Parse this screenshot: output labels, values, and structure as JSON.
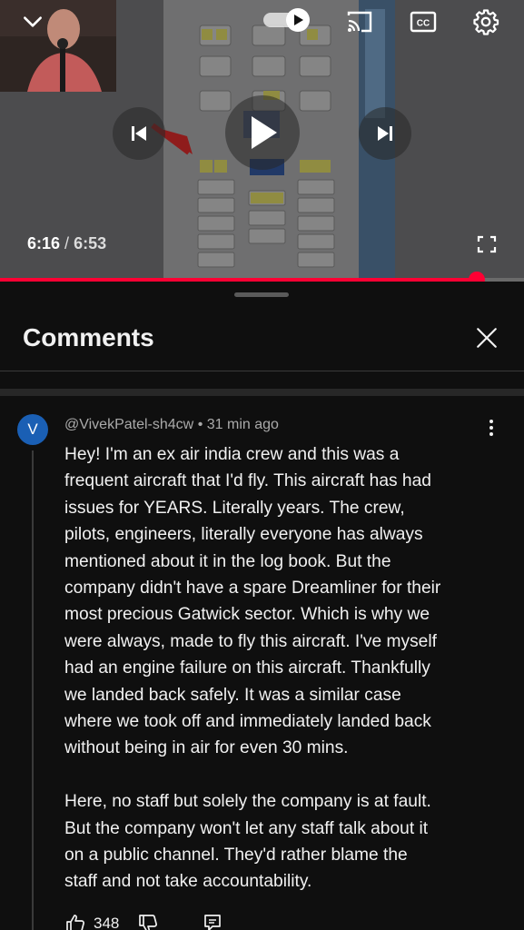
{
  "player": {
    "current_time": "6:16",
    "time_separator": "/",
    "duration": "6:53",
    "progress_fraction": 0.91,
    "accent_color": "#ff0033"
  },
  "controls": {
    "icons": [
      "chevron-down-icon",
      "autoplay-toggle-icon",
      "cast-icon",
      "closed-captions-icon",
      "gear-icon",
      "skip-previous-icon",
      "play-icon",
      "skip-next-icon",
      "fullscreen-icon"
    ]
  },
  "panel": {
    "title": "Comments",
    "close_icon": "close-icon"
  },
  "comment": {
    "avatar_letter": "V",
    "avatar_color": "#1a5fb4",
    "author": "@VivekPatel-sh4cw",
    "meta_separator": "•",
    "time_ago": "31 min ago",
    "body_lines": [
      "Hey! I'm an ex air india crew and this was a",
      "frequent aircraft that I'd fly. This aircraft has had",
      "issues for YEARS. Literally years. The crew,",
      "pilots, engineers, literally everyone has always",
      "mentioned about it in the log book. But the",
      "company didn't have a spare Dreamliner for their",
      "most precious Gatwick sector. Which is why we",
      "were always, made to fly this aircraft. I've myself",
      "had an engine failure on this aircraft. Thankfully",
      "we landed back safely. It was a similar case",
      "where we took off and immediately landed back",
      "without being in air for even 30 mins.",
      "",
      "Here, no staff but solely the company is at fault.",
      "But the company won't let any staff talk about it",
      "on a public channel. They'd rather blame the",
      "staff and not take accountability."
    ],
    "like_count": "348"
  }
}
